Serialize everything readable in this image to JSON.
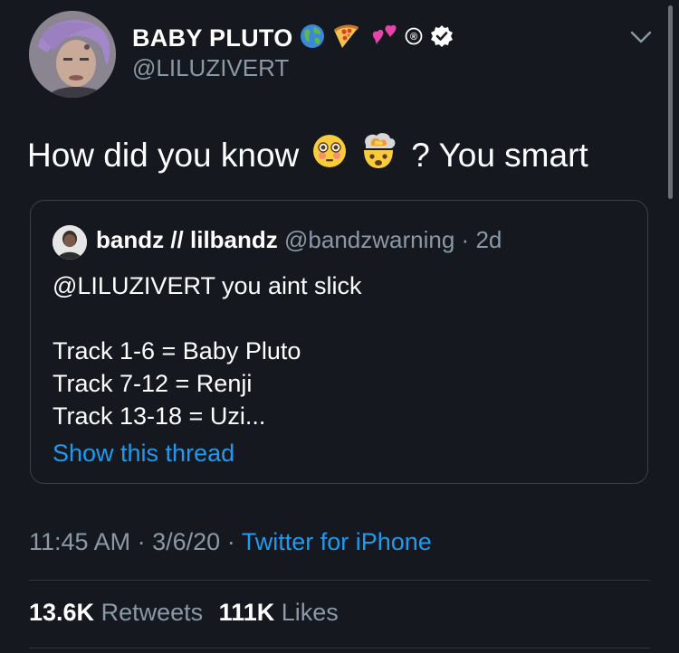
{
  "author": {
    "display_name": "BABY PLUTO",
    "name_emojis": [
      "globe-emoji",
      "pizza-emoji",
      "two-hearts-emoji"
    ],
    "registered_mark": "®",
    "verified": true,
    "handle": "@LILUZIVERT",
    "avatar_icon": "profile-photo"
  },
  "tweet": {
    "text_before": "How did you know",
    "emojis": [
      "flushed-face-emoji",
      "exploding-head-emoji"
    ],
    "text_after": "? You smart"
  },
  "quoted_tweet": {
    "display_name": "bandz // lilbandz",
    "handle": "@bandzwarning",
    "separator": "·",
    "time": "2d",
    "lines": [
      "@LILUZIVERT you aint slick",
      "",
      "Track 1-6 = Baby Pluto",
      "Track 7-12 = Renji",
      "Track 13-18 = Uzi..."
    ],
    "show_thread": "Show this thread"
  },
  "meta": {
    "time": "11:45 AM",
    "separator": "·",
    "date": "3/6/20",
    "source": "Twitter for iPhone"
  },
  "stats": {
    "retweets_count": "13.6K",
    "retweets_label": "Retweets",
    "likes_count": "111K",
    "likes_label": "Likes"
  },
  "colors": {
    "background": "#15181f",
    "link": "#1d9bf0",
    "secondary_text": "#8b98a5",
    "border": "#3a4049"
  }
}
